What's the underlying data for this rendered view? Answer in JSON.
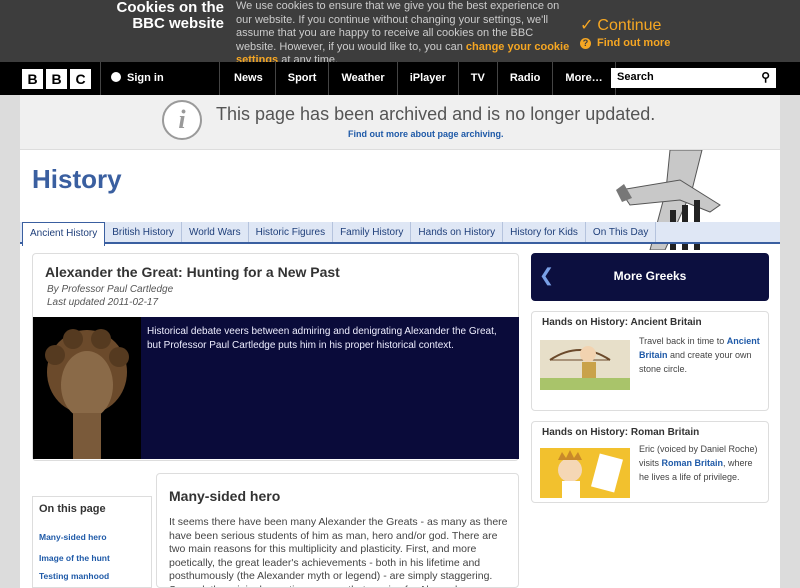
{
  "cookie": {
    "title_line1": "Cookies on the",
    "title_line2": "BBC website",
    "message_part1": "We use cookies to ensure that we give you the best experience on our website. If you continue without changing your settings, we'll assume that you are happy to receive all cookies on the BBC website. However, if you would like to, you can ",
    "message_link": "change your cookie settings",
    "message_part2": " at any time.",
    "continue_label": "Continue",
    "find_out_more": "Find out more"
  },
  "bbcbar": {
    "logo": [
      "B",
      "B",
      "C"
    ],
    "sign_in": "Sign in",
    "nav": [
      "News",
      "Sport",
      "Weather",
      "iPlayer",
      "TV",
      "Radio",
      "More…"
    ],
    "search_placeholder": "Search"
  },
  "archive": {
    "message": "This page has been archived and is no longer updated.",
    "link": "Find out more about page archiving."
  },
  "section": {
    "title": "History",
    "tabs": [
      "Ancient History",
      "British History",
      "World Wars",
      "Historic Figures",
      "Family History",
      "Hands on History",
      "History for Kids",
      "On This Day"
    ]
  },
  "article": {
    "title": "Alexander the Great: Hunting for a New Past",
    "byline": "By Professor Paul Cartledge",
    "updated": "Last updated 2011-02-17",
    "blurb": "Historical debate veers between admiring and denigrating Alexander the Great, but Professor Paul Cartledge puts him in his proper historical context."
  },
  "sidebar": {
    "more_title": "More Greeks",
    "promo1": {
      "heading": "Hands on History: Ancient Britain",
      "text1": "Travel back in time to ",
      "link": "Ancient Britain",
      "text2": " and create your own stone circle."
    },
    "promo2": {
      "heading": "Hands on History: Roman Britain",
      "text1": "Eric (voiced by Daniel Roche) visits ",
      "link": "Roman Britain",
      "text2": ", where he lives a life of privilege."
    }
  },
  "on_this_page": {
    "heading": "On this page",
    "links": [
      "Many-sided hero",
      "Image of the hunt",
      "Testing manhood"
    ]
  },
  "body_section": {
    "title": "Many-sided hero",
    "text": "It seems there have been many Alexander the Greats - as many as there have been serious students of him as man, hero and/or god. There are two main reasons for this multiplicity and plasticity. First, and more poetically, the great leader's achievements - both in his lifetime and posthumously (the Alexander myth or legend) - are simply staggering. Second, the original narrative sources that survive for Alexander are"
  }
}
